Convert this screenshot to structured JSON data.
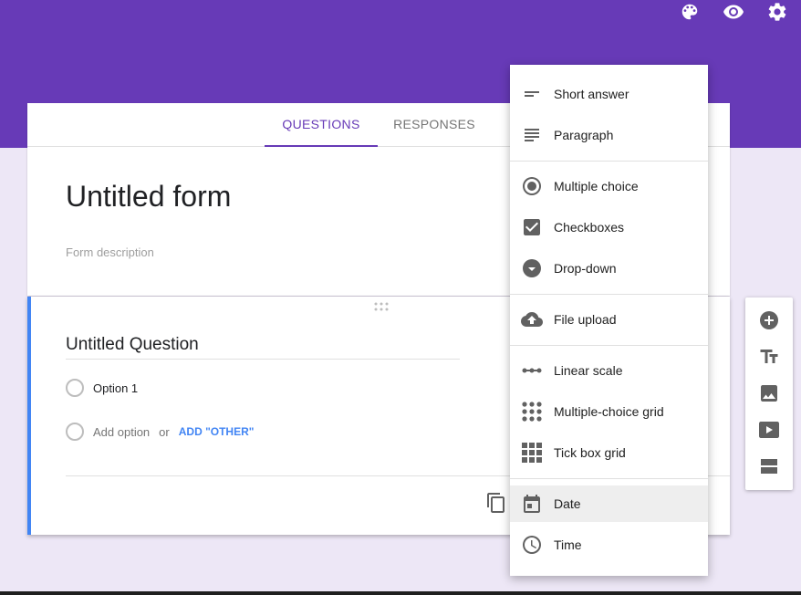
{
  "tabs": {
    "questions": "QUESTIONS",
    "responses": "RESPONSES"
  },
  "form": {
    "title": "Untitled form",
    "description_placeholder": "Form description"
  },
  "question": {
    "title": "Untitled Question",
    "option1": "Option 1",
    "add_option": "Add option",
    "or": "or",
    "add_other": "ADD \"OTHER\""
  },
  "menu": {
    "short_answer": "Short answer",
    "paragraph": "Paragraph",
    "multiple_choice": "Multiple choice",
    "checkboxes": "Checkboxes",
    "dropdown": "Drop-down",
    "file_upload": "File upload",
    "linear_scale": "Linear scale",
    "multiple_choice_grid": "Multiple-choice grid",
    "tick_box_grid": "Tick box grid",
    "date": "Date",
    "time": "Time"
  },
  "icons": {
    "top": [
      "palette-icon",
      "preview-eye-icon",
      "settings-gear-icon"
    ],
    "toolbar": [
      "add-question-icon",
      "add-title-icon",
      "add-image-icon",
      "add-video-icon",
      "add-section-icon"
    ]
  },
  "colors": {
    "brand": "#673ab7",
    "accent_blue": "#4285f4",
    "background": "#ede7f6"
  }
}
